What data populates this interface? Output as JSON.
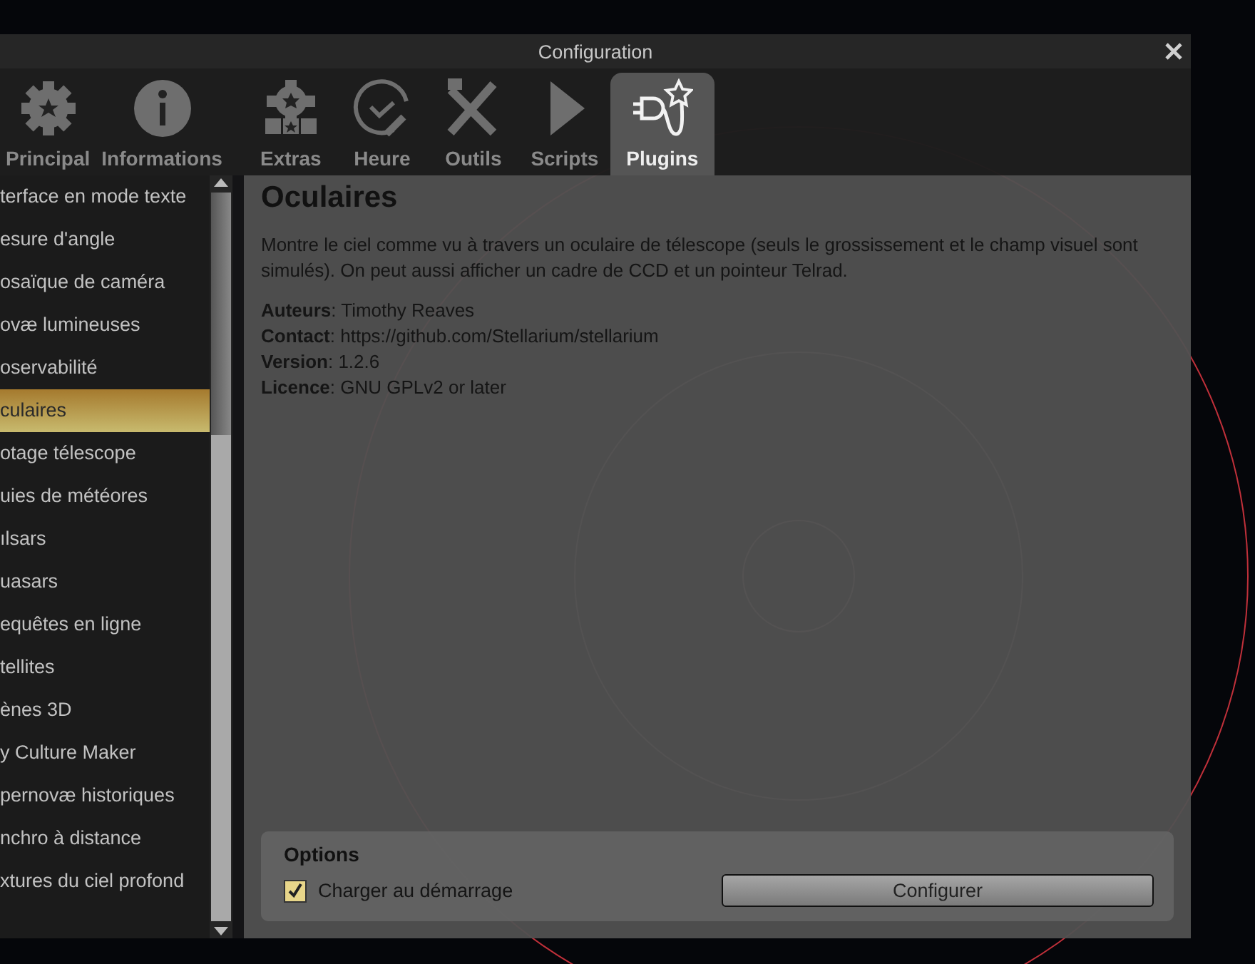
{
  "window": {
    "title": "Configuration"
  },
  "tabs": [
    {
      "label": "Principal",
      "selected": false
    },
    {
      "label": "Informations",
      "selected": false
    },
    {
      "label": "Extras",
      "selected": false
    },
    {
      "label": "Heure",
      "selected": false
    },
    {
      "label": "Outils",
      "selected": false
    },
    {
      "label": "Scripts",
      "selected": false
    },
    {
      "label": "Plugins",
      "selected": true
    }
  ],
  "plugin_list": [
    {
      "label": "terface en mode texte",
      "selected": false
    },
    {
      "label": "esure d'angle",
      "selected": false
    },
    {
      "label": "osaïque de caméra",
      "selected": false
    },
    {
      "label": "ovæ lumineuses",
      "selected": false
    },
    {
      "label": "oservabilité",
      "selected": false
    },
    {
      "label": "culaires",
      "selected": true
    },
    {
      "label": "otage télescope",
      "selected": false
    },
    {
      "label": "uies de météores",
      "selected": false
    },
    {
      "label": "ılsars",
      "selected": false
    },
    {
      "label": "uasars",
      "selected": false
    },
    {
      "label": "equêtes en ligne",
      "selected": false
    },
    {
      "label": "tellites",
      "selected": false
    },
    {
      "label": "ènes 3D",
      "selected": false
    },
    {
      "label": "y Culture Maker",
      "selected": false
    },
    {
      "label": "pernovæ historiques",
      "selected": false
    },
    {
      "label": "nchro à distance",
      "selected": false
    },
    {
      "label": "xtures du ciel profond",
      "selected": false
    }
  ],
  "plugin_detail": {
    "title": "Oculaires",
    "description": "Montre le ciel comme vu à travers un oculaire de télescope (seuls le grossissement et le champ visuel sont simulés). On peut aussi afficher un cadre de CCD et un pointeur Telrad.",
    "fields": [
      "**Auteurs**: Timothy Reaves",
      "**Contact**: https://github.com/Stellarium/stellarium",
      "**Version**: 1.2.6",
      "**Licence**: GNU GPLv2 or later"
    ]
  },
  "options": {
    "title": "Options",
    "load_at_startup": {
      "label": "Charger au démarrage",
      "checked": true
    },
    "button": "Configurer"
  }
}
